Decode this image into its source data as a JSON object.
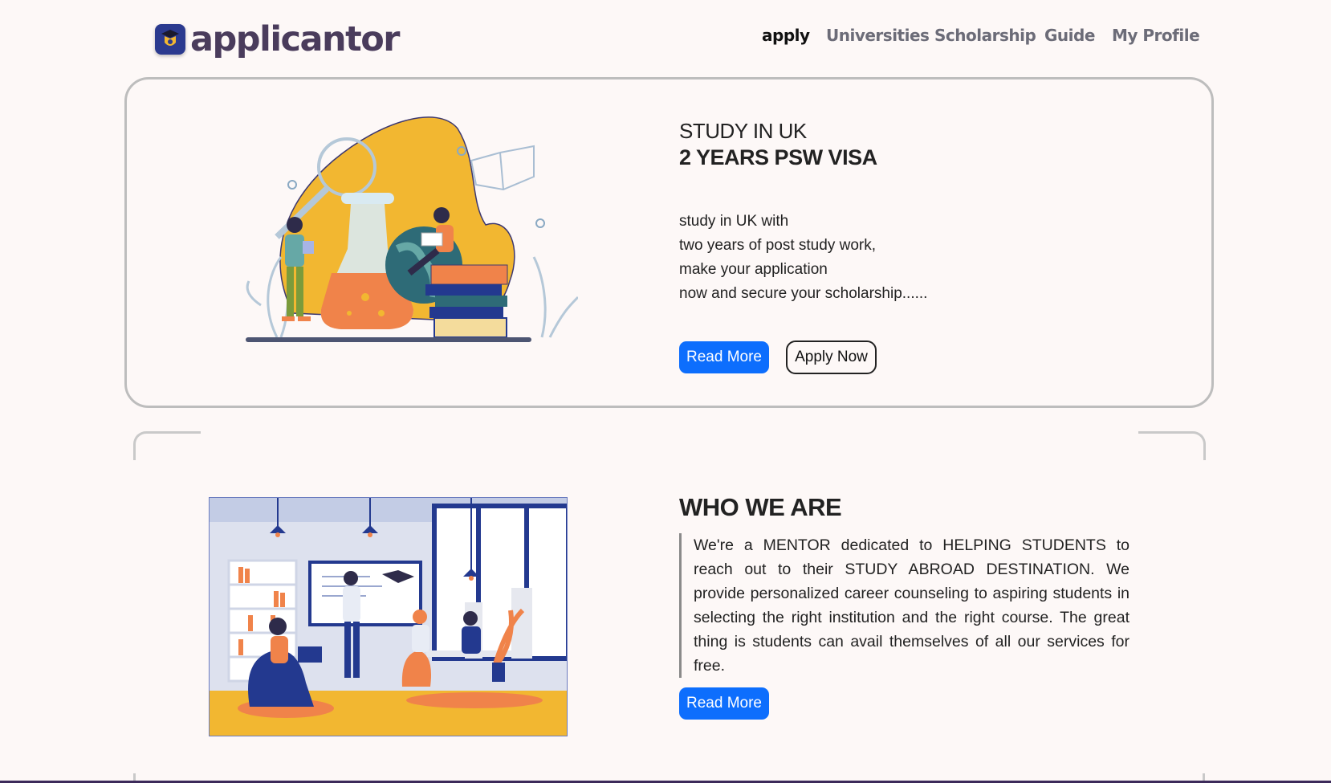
{
  "header": {
    "brand": "applicantor",
    "logo_icon": "mortarboard-shield-icon",
    "nav": [
      {
        "label": "apply",
        "active": true
      },
      {
        "label": "Universities",
        "active": false
      },
      {
        "label": "Scholarship",
        "active": false
      },
      {
        "label": "Guide",
        "active": false
      },
      {
        "label": "My Profile",
        "active": false
      }
    ]
  },
  "hero": {
    "title_line1": "STUDY IN UK",
    "title_line2": "2 YEARS PSW VISA",
    "lines": [
      "study in UK with",
      "two years of post study work,",
      "make your application",
      "now and secure your scholarship......"
    ],
    "read_more_label": "Read More",
    "apply_now_label": "Apply Now",
    "illustration": "students-science-flask-books-illustration"
  },
  "who_we_are": {
    "title": "WHO WE ARE",
    "text": "We're a MENTOR dedicated to HELPING STUDENTS to reach out to their STUDY ABROAD DESTINATION. We provide personalized career counseling to aspiring students in selecting the right institution and the right course. The great thing is students can avail themselves of all our services for free.",
    "read_more_label": "Read More",
    "illustration": "office-team-meeting-illustration"
  },
  "colors": {
    "background": "#fdf8f7",
    "primary": "#0d6efd",
    "brand": "#4a3c5c",
    "card_border": "#bdbdbd",
    "accent_yellow": "#f2b731",
    "accent_orange": "#f0834a",
    "accent_navy": "#23398f"
  }
}
